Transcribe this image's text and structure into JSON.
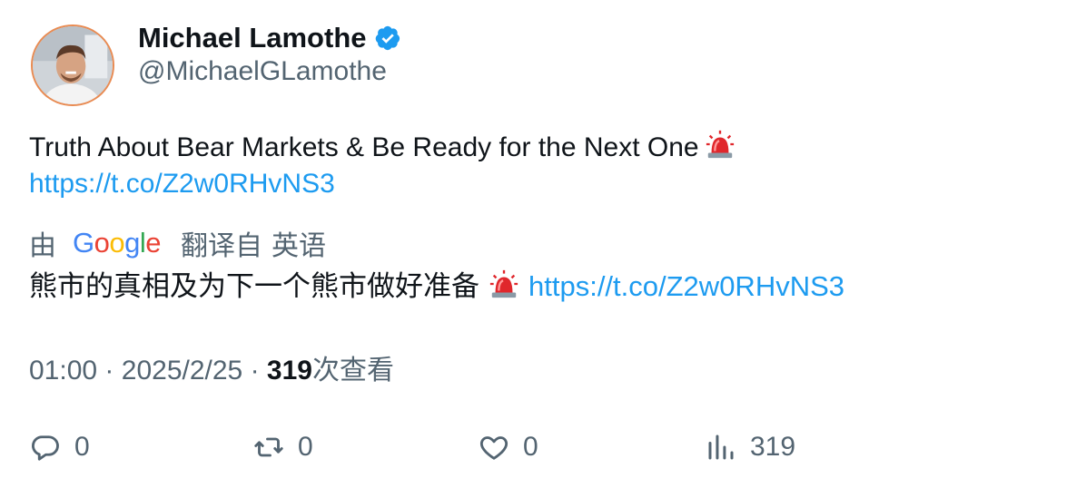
{
  "author": {
    "display_name": "Michael Lamothe",
    "handle": "@MichaelGLamothe",
    "verified_icon": "verified-badge-icon",
    "verified_color": "#1d9bf0",
    "avatar_ring_color": "#e98b52"
  },
  "tweet": {
    "text": "Truth About Bear Markets & Be Ready for the Next One",
    "emoji_icon": "rotating-light-icon",
    "link": "https://t.co/Z2w0RHvNS3"
  },
  "translation": {
    "by_label": "由",
    "google": {
      "letters": [
        "G",
        "o",
        "o",
        "g",
        "l",
        "e"
      ]
    },
    "from_label": "翻译自",
    "language": "英语",
    "text": "熊市的真相及为下一个熊市做好准备",
    "link": "https://t.co/Z2w0RHvNS3"
  },
  "meta": {
    "time": "01:00",
    "dot1": "·",
    "date": "2025/2/25",
    "dot2": "·",
    "views_count": "319",
    "views_label": "次查看"
  },
  "actions": {
    "reply_count": "0",
    "retweet_count": "0",
    "like_count": "0",
    "views_count": "319"
  },
  "colors": {
    "link": "#1d9bf0",
    "muted": "#536471",
    "text": "#0f1419"
  }
}
